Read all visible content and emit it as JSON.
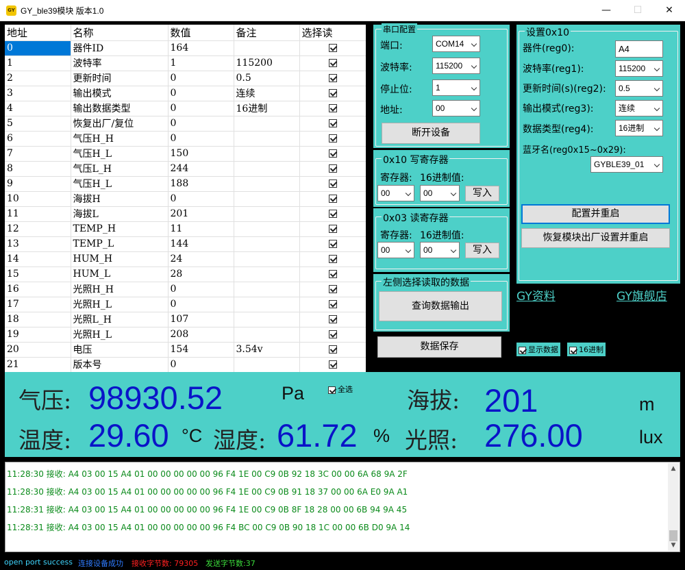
{
  "window": {
    "icon_text": "GY",
    "title": "GY_ble39模块 版本1.0",
    "minimize": "—",
    "maximize": "☐",
    "close": "✕"
  },
  "table": {
    "headers": [
      "地址",
      "名称",
      "数值",
      "备注",
      "选择读"
    ],
    "rows": [
      {
        "addr": "0",
        "name": "器件ID",
        "value": "164",
        "note": ""
      },
      {
        "addr": "1",
        "name": "波特率",
        "value": "1",
        "note": "115200"
      },
      {
        "addr": "2",
        "name": "更新时间",
        "value": "0",
        "note": "0.5"
      },
      {
        "addr": "3",
        "name": "输出模式",
        "value": "0",
        "note": "连续"
      },
      {
        "addr": "4",
        "name": "输出数据类型",
        "value": "0",
        "note": "16进制"
      },
      {
        "addr": "5",
        "name": "恢复出厂/复位",
        "value": "0",
        "note": ""
      },
      {
        "addr": "6",
        "name": "气压H_H",
        "value": "0",
        "note": ""
      },
      {
        "addr": "7",
        "name": "气压H_L",
        "value": "150",
        "note": ""
      },
      {
        "addr": "8",
        "name": "气压L_H",
        "value": "244",
        "note": ""
      },
      {
        "addr": "9",
        "name": "气压H_L",
        "value": "188",
        "note": ""
      },
      {
        "addr": "10",
        "name": "海拔H",
        "value": "0",
        "note": ""
      },
      {
        "addr": "11",
        "name": "海拔L",
        "value": "201",
        "note": ""
      },
      {
        "addr": "12",
        "name": "TEMP_H",
        "value": "11",
        "note": ""
      },
      {
        "addr": "13",
        "name": "TEMP_L",
        "value": "144",
        "note": ""
      },
      {
        "addr": "14",
        "name": "HUM_H",
        "value": "24",
        "note": ""
      },
      {
        "addr": "15",
        "name": "HUM_L",
        "value": "28",
        "note": ""
      },
      {
        "addr": "16",
        "name": "光照H_H",
        "value": "0",
        "note": ""
      },
      {
        "addr": "17",
        "name": "光照H_L",
        "value": "0",
        "note": ""
      },
      {
        "addr": "18",
        "name": "光照L_H",
        "value": "107",
        "note": ""
      },
      {
        "addr": "19",
        "name": "光照H_L",
        "value": "208",
        "note": ""
      },
      {
        "addr": "20",
        "name": "电压",
        "value": "154",
        "note": "3.54v"
      },
      {
        "addr": "21",
        "name": "版本号",
        "value": "0",
        "note": ""
      }
    ]
  },
  "serial": {
    "title": "串口配置",
    "port_label": "端口:",
    "port_value": "COM14",
    "baud_label": "波特率:",
    "baud_value": "115200",
    "stop_label": "停止位:",
    "stop_value": "1",
    "addr_label": "地址:",
    "addr_value": "00",
    "disconnect_label": "断开设备"
  },
  "write_reg": {
    "title": "0x10 写寄存器",
    "reg_label": "寄存器:",
    "hex_label": "16进制值:",
    "reg_value": "00",
    "hex_value": "00",
    "write_label": "写入"
  },
  "read_reg": {
    "title": "0x03 读寄存器",
    "reg_label": "寄存器:",
    "hex_label": "16进制值:",
    "reg_value": "00",
    "hex_value": "00",
    "write_label": "写入"
  },
  "query": {
    "title": "左侧选择读取的数据",
    "query_label": "查询数据输出"
  },
  "save_label": "数据保存",
  "settings": {
    "title": "设置0x10",
    "device_label": "器件(reg0):",
    "device_value": "A4",
    "baud_label": "波特率(reg1):",
    "baud_value": "115200",
    "update_label": "更新时间(s)(reg2):",
    "update_value": "0.5",
    "mode_label": "输出模式(reg3):",
    "mode_value": "连续",
    "type_label": "数据类型(reg4):",
    "type_value": "16进制",
    "bt_label": "蓝牙名(reg0x15~0x29):",
    "bt_value": "GYBLE39_01",
    "config_label": "配置并重启",
    "restore_label": "恢复模块出厂设置并重启"
  },
  "links": {
    "gy_docs": "GY资料",
    "gy_store": "GY旗舰店"
  },
  "options": {
    "show_data": "显示数据",
    "hex": "16进制",
    "select_all": "全选"
  },
  "readings": {
    "pressure_label": "气压:",
    "pressure_value": "98930.52",
    "pressure_unit": "Pa",
    "altitude_label": "海拔:",
    "altitude_value": "201",
    "altitude_unit": "m",
    "temp_label": "温度:",
    "temp_value": "29.60",
    "temp_unit": "°C",
    "hum_label": "湿度:",
    "hum_value": "61.72",
    "hum_unit": "%",
    "light_label": "光照:",
    "light_value": "276.00",
    "light_unit": "lux"
  },
  "log": [
    "11:28:30 接收:  A4 03 00 15 A4 01 00 00 00 00 00 96 F4 1E 00 C9 0B 92 18 3C 00 00 6A 68 9A 2F",
    "11:28:30 接收:  A4 03 00 15 A4 01 00 00 00 00 00 96 F4 1E 00 C9 0B 91 18 37 00 00 6A E0 9A A1",
    "11:28:31 接收:  A4 03 00 15 A4 01 00 00 00 00 00 96 F4 1E 00 C9 0B 8F 18 28 00 00 6B 94 9A 45",
    "11:28:31 接收:  A4 03 00 15 A4 01 00 00 00 00 00 96 F4 BC 00 C9 0B 90 18 1C 00 00 6B D0 9A 14"
  ],
  "status": {
    "port": "open port success",
    "device": "连接设备成功",
    "rx": "接收字节数: 79305",
    "tx": "发送字节数:37"
  },
  "colors": {
    "panel": "#4dd0c8",
    "value_blue": "#0a14c8",
    "log_green": "#0a8a1a"
  }
}
